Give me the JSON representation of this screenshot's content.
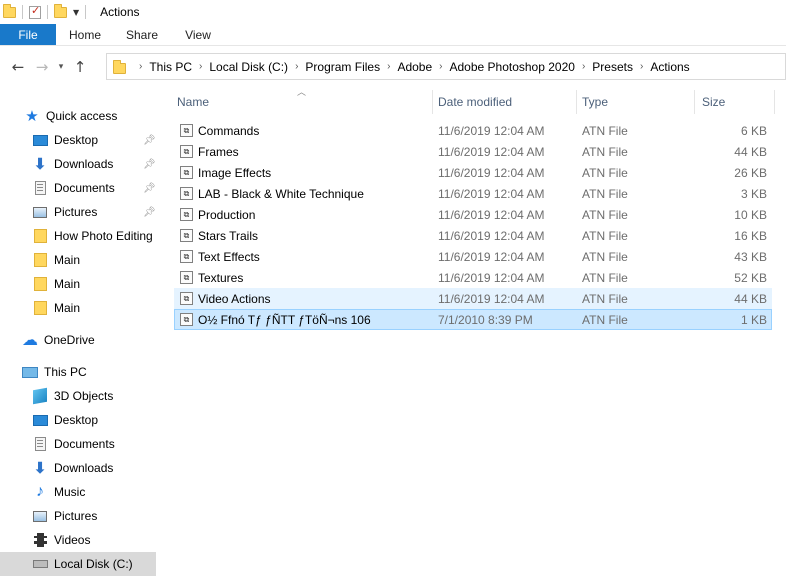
{
  "window": {
    "title": "Actions"
  },
  "ribbon": {
    "tabs": [
      "File",
      "Home",
      "Share",
      "View"
    ]
  },
  "address": {
    "breadcrumbs": [
      "This PC",
      "Local Disk (C:)",
      "Program Files",
      "Adobe",
      "Adobe Photoshop 2020",
      "Presets",
      "Actions"
    ]
  },
  "columns": {
    "name": "Name",
    "date": "Date modified",
    "type": "Type",
    "size": "Size"
  },
  "files": [
    {
      "name": "Commands",
      "date": "11/6/2019 12:04 AM",
      "type": "ATN File",
      "size": "6 KB"
    },
    {
      "name": "Frames",
      "date": "11/6/2019 12:04 AM",
      "type": "ATN File",
      "size": "44 KB"
    },
    {
      "name": "Image Effects",
      "date": "11/6/2019 12:04 AM",
      "type": "ATN File",
      "size": "26 KB"
    },
    {
      "name": "LAB - Black & White Technique",
      "date": "11/6/2019 12:04 AM",
      "type": "ATN File",
      "size": "3 KB"
    },
    {
      "name": "Production",
      "date": "11/6/2019 12:04 AM",
      "type": "ATN File",
      "size": "10 KB"
    },
    {
      "name": "Stars Trails",
      "date": "11/6/2019 12:04 AM",
      "type": "ATN File",
      "size": "16 KB"
    },
    {
      "name": "Text Effects",
      "date": "11/6/2019 12:04 AM",
      "type": "ATN File",
      "size": "43 KB"
    },
    {
      "name": "Textures",
      "date": "11/6/2019 12:04 AM",
      "type": "ATN File",
      "size": "52 KB"
    },
    {
      "name": "Video Actions",
      "date": "11/6/2019 12:04 AM",
      "type": "ATN File",
      "size": "44 KB"
    },
    {
      "name": "O½ Ffnó Tƒ ƒÑTT ƒTöÑ¬ns 106",
      "date": "7/1/2010 8:39 PM",
      "type": "ATN File",
      "size": "1 KB"
    }
  ],
  "nav": {
    "quick_access": "Quick access",
    "quick_items": [
      "Desktop",
      "Downloads",
      "Documents",
      "Pictures",
      "How Photo Editing",
      "Main",
      "Main",
      "Main"
    ],
    "onedrive": "OneDrive",
    "this_pc": "This PC",
    "pc_items": [
      "3D Objects",
      "Desktop",
      "Documents",
      "Downloads",
      "Music",
      "Pictures",
      "Videos",
      "Local Disk (C:)"
    ]
  },
  "colors": {
    "file_tab": "#1979ca",
    "selection": "#cce8ff",
    "hover": "#e5f3ff",
    "header_text": "#4c607a"
  }
}
